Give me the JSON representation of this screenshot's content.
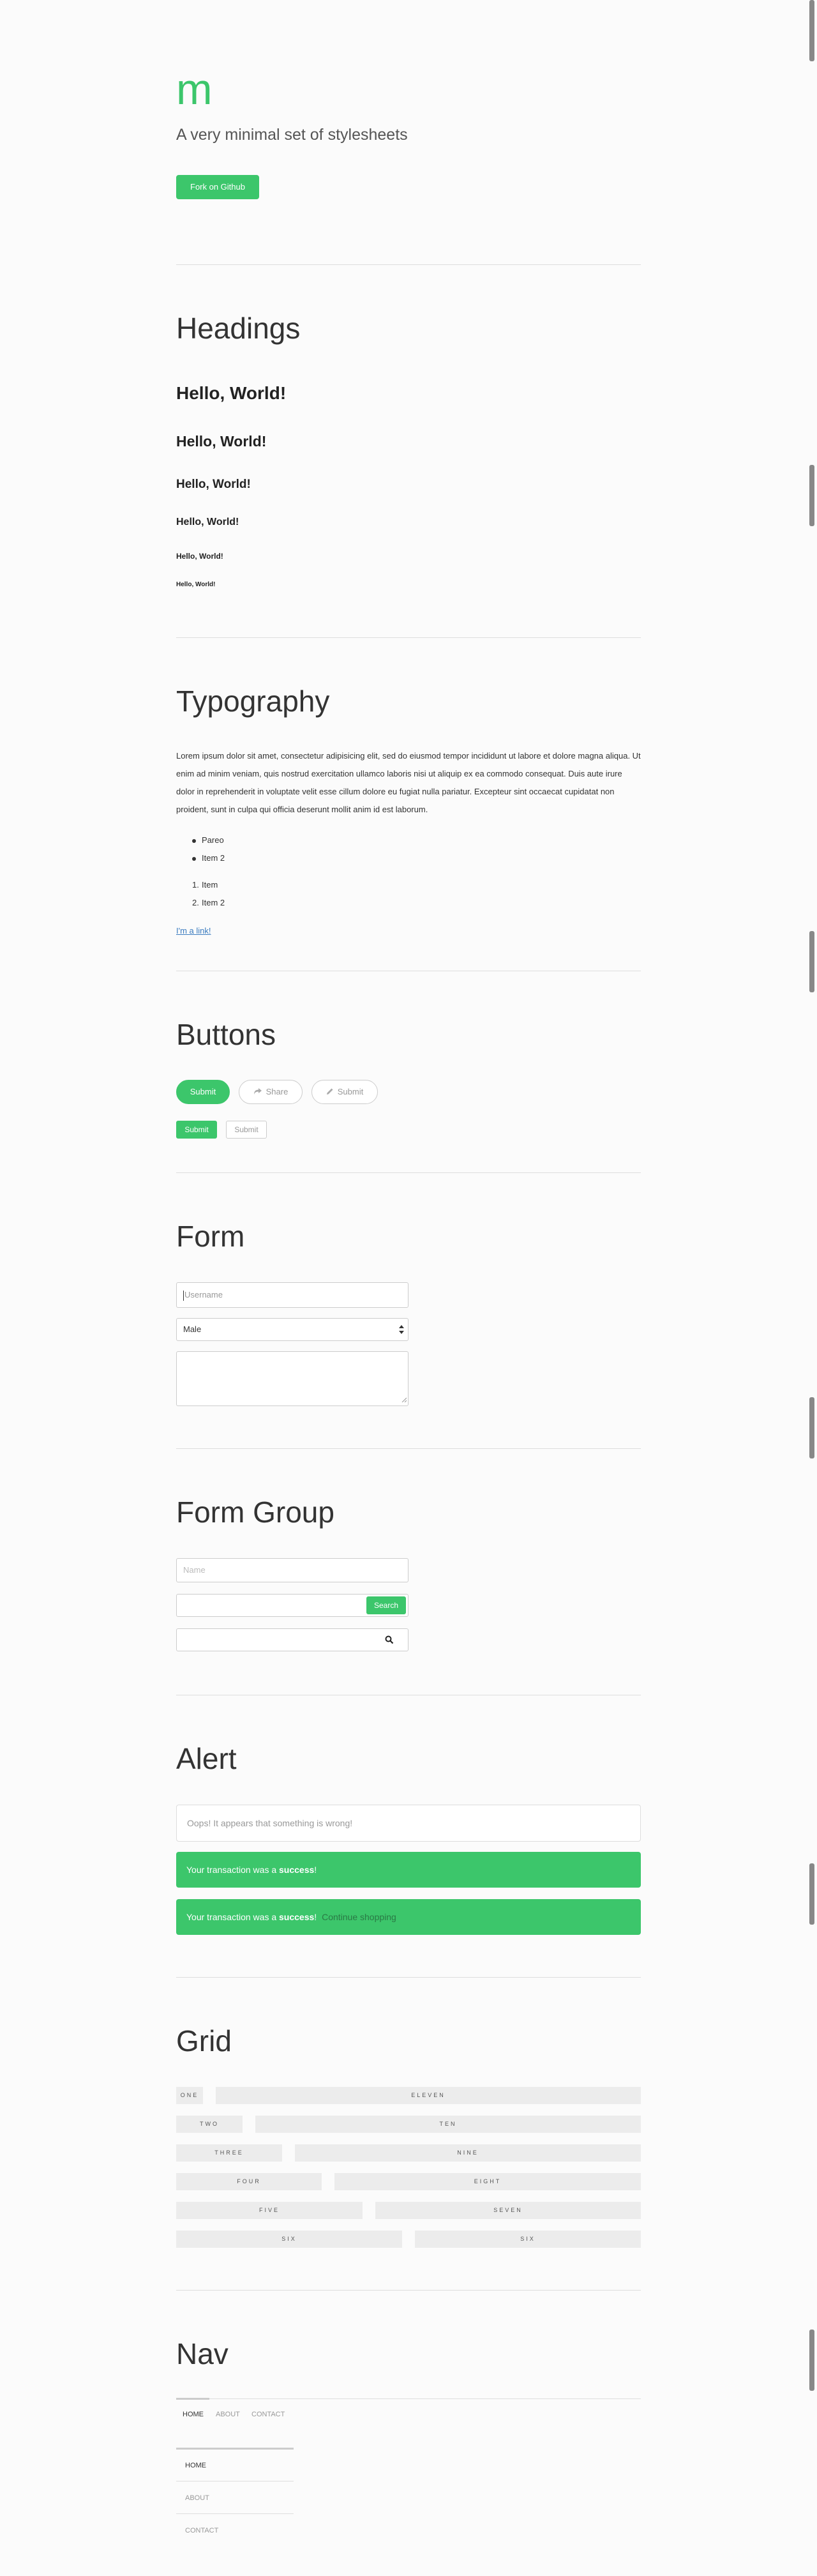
{
  "header": {
    "logo": "m",
    "tagline": "A very minimal set of stylesheets",
    "fork_button": "Fork on Github"
  },
  "headings": {
    "title": "Headings",
    "samples": [
      "Hello, World!",
      "Hello, World!",
      "Hello, World!",
      "Hello, World!",
      "Hello, World!",
      "Hello, World!"
    ]
  },
  "typography": {
    "title": "Typography",
    "paragraph": "Lorem ipsum dolor sit amet, consectetur adipisicing elit, sed do eiusmod tempor incididunt ut labore et dolore magna aliqua. Ut enim ad minim veniam, quis nostrud exercitation ullamco laboris nisi ut aliquip ex ea commodo consequat. Duis aute irure dolor in reprehenderit in voluptate velit esse cillum dolore eu fugiat nulla pariatur. Excepteur sint occaecat cupidatat non proident, sunt in culpa qui officia deserunt mollit anim id est laborum.",
    "unordered": [
      "Pareo",
      "Item 2"
    ],
    "ordered": [
      "Item",
      "Item 2"
    ],
    "ordered_numbers": [
      "1.",
      "2."
    ],
    "link": "I'm a link!"
  },
  "buttons": {
    "title": "Buttons",
    "row1": {
      "submit": "Submit",
      "share": "Share",
      "submit_outline": "Submit"
    },
    "row2": {
      "submit": "Submit",
      "submit_outline": "Submit"
    }
  },
  "form": {
    "title": "Form",
    "username_placeholder": "Username",
    "select_value": "Male"
  },
  "form_group": {
    "title": "Form Group",
    "name_placeholder": "Name",
    "search_button": "Search"
  },
  "alert": {
    "title": "Alert",
    "warning": "Oops! It appears that something is wrong!",
    "success1_prefix": "Your transaction was a ",
    "success1_bold": "success",
    "success1_suffix": "!",
    "success2_prefix": "Your transaction was a ",
    "success2_bold": "success",
    "success2_suffix": "!",
    "success2_link": "Continue shopping"
  },
  "grid": {
    "title": "Grid",
    "rows": [
      [
        "one",
        "eleven"
      ],
      [
        "two",
        "ten"
      ],
      [
        "three",
        "nine"
      ],
      [
        "four",
        "eight"
      ],
      [
        "five",
        "seven"
      ],
      [
        "six",
        "six"
      ]
    ]
  },
  "nav": {
    "title": "Nav",
    "top_items": [
      "HOME",
      "ABOUT",
      "CONTACT"
    ],
    "side_items": [
      "HOME",
      "ABOUT",
      "CONTACT"
    ]
  },
  "colors": {
    "accent": "#3cc66b",
    "link": "#3a7bbf",
    "grid_bg": "#ececec"
  }
}
